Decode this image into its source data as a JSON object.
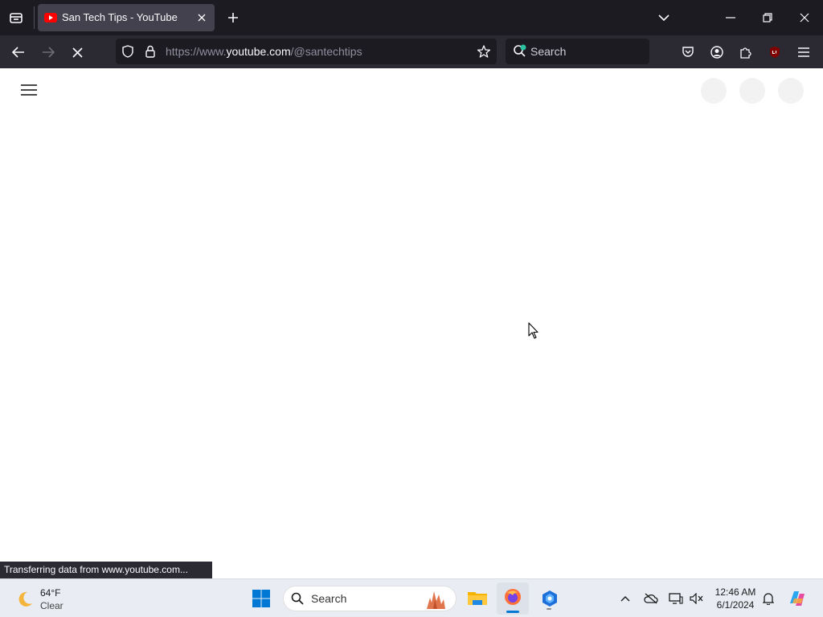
{
  "browser": {
    "tab": {
      "title": "San Tech Tips - YouTube"
    },
    "url": {
      "prefix": "https://www.",
      "domain": "youtube.com",
      "path": "/@santechtips"
    },
    "search_placeholder": "Search",
    "status_text": "Transferring data from www.youtube.com..."
  },
  "taskbar": {
    "weather": {
      "temp": "64°F",
      "condition": "Clear"
    },
    "search_placeholder": "Search",
    "clock": {
      "time": "12:46 AM",
      "date": "6/1/2024"
    }
  },
  "colors": {
    "youtube_red": "#ff0000",
    "accent_blue": "#0078d4"
  }
}
